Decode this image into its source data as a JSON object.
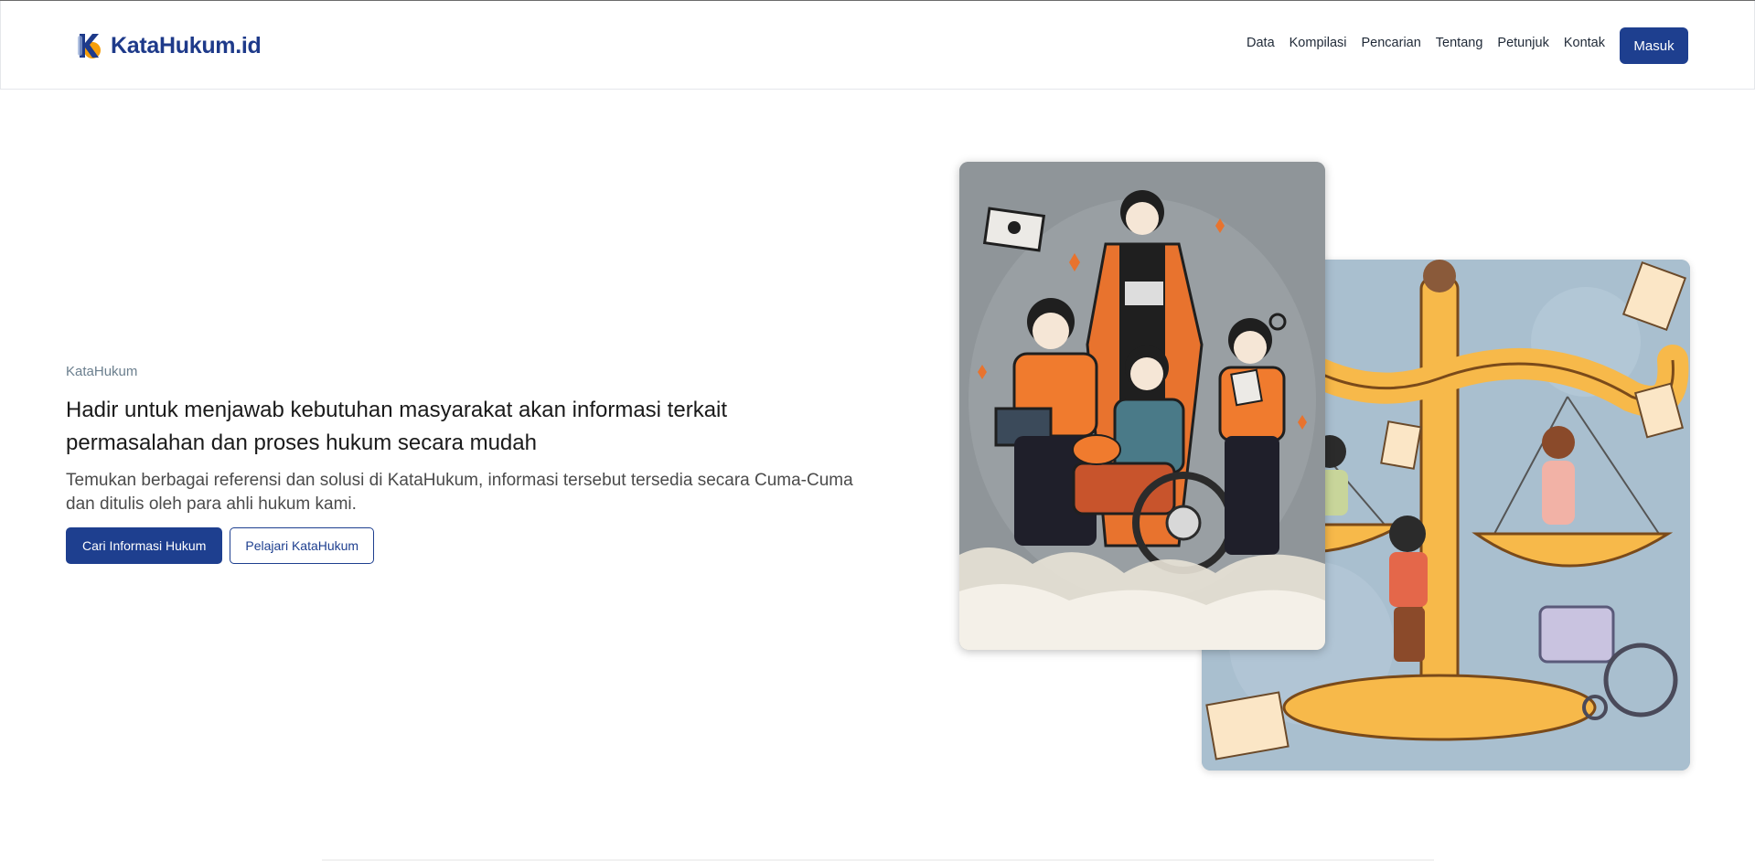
{
  "app": {
    "brand": "KataHukum.id"
  },
  "colors": {
    "primary": "#1e3f8f",
    "accent": "#f59e0b"
  },
  "nav": {
    "items": [
      {
        "label": "Data"
      },
      {
        "label": "Kompilasi"
      },
      {
        "label": "Pencarian"
      },
      {
        "label": "Tentang"
      },
      {
        "label": "Petunjuk"
      },
      {
        "label": "Kontak"
      }
    ],
    "login_label": "Masuk"
  },
  "hero": {
    "eyebrow": "KataHukum",
    "headline": "Hadir untuk menjawab kebutuhan masyarakat akan informasi terkait permasalahan dan proses hukum secara mudah",
    "subtext": "Temukan berbagai referensi dan solusi di KataHukum, informasi tersebut tersedia secara Cuma-Cuma dan ditulis oleh para ahli hukum kami.",
    "primary_button": "Cari Informasi Hukum",
    "secondary_button": "Pelajari KataHukum"
  },
  "illustrations": {
    "front": "people-with-judge-illustration",
    "back": "scales-of-justice-illustration"
  }
}
